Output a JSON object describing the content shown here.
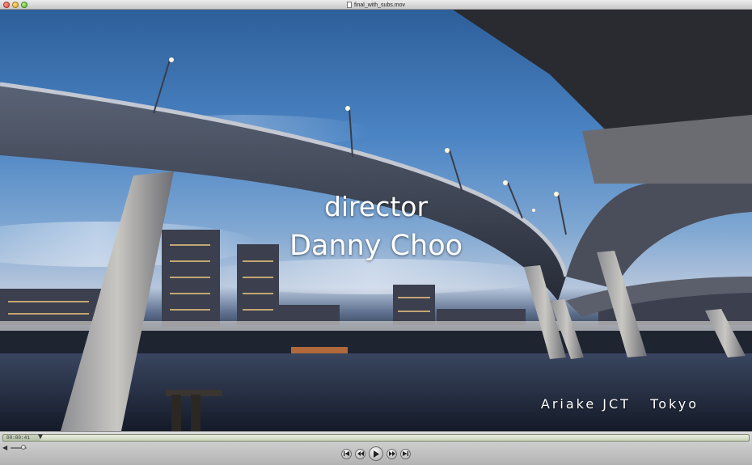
{
  "window": {
    "title": "final_with_subs.mov"
  },
  "video": {
    "subtitle_role": "director",
    "subtitle_name": "Danny Choo",
    "location_caption": "Ariake JCT   Tokyo"
  },
  "controls": {
    "timecode": "00:00:41",
    "progress_fraction": 0.05,
    "volume_fraction": 0.8
  },
  "icons": {
    "volume": "speaker-icon",
    "skip_back": "skip-to-start-icon",
    "rewind": "rewind-icon",
    "play": "play-icon",
    "fast_forward": "fast-forward-icon",
    "skip_forward": "skip-to-end-icon"
  },
  "colors": {
    "window_chrome": "#c9c9c9",
    "caption_text": "#ffffff",
    "scrubber_bg": "#d6ddc8"
  }
}
